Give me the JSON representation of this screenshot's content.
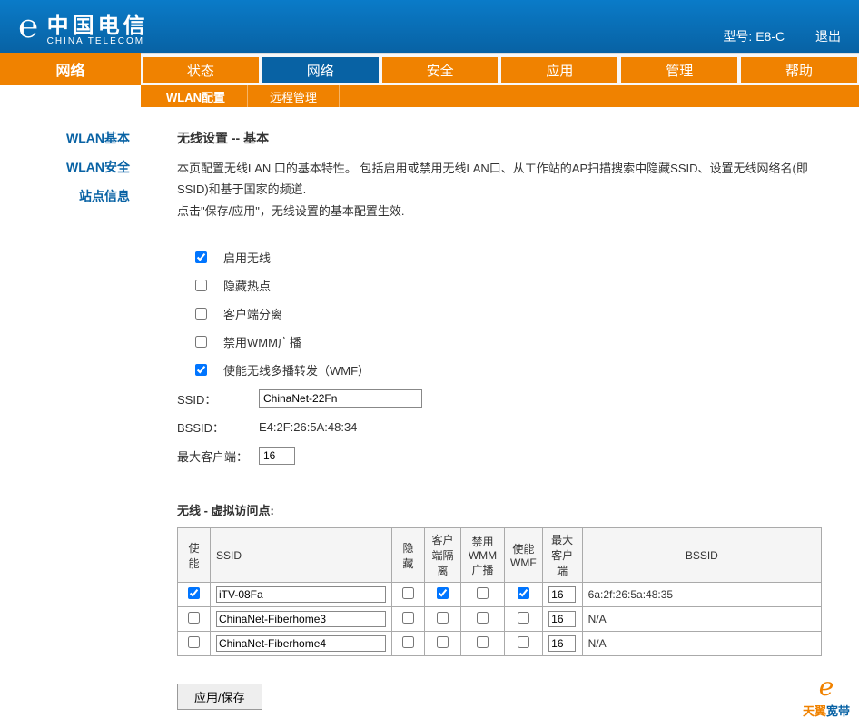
{
  "header": {
    "brand_cn": "中国电信",
    "brand_en": "CHINA TELECOM",
    "model_label": "型号: E8-C",
    "logout": "退出"
  },
  "nav": {
    "current": "网络",
    "tabs": [
      "状态",
      "网络",
      "安全",
      "应用",
      "管理",
      "帮助"
    ],
    "active_index": 1
  },
  "subnav": {
    "tabs": [
      "WLAN配置",
      "远程管理"
    ],
    "active_index": 0
  },
  "sidebar": {
    "items": [
      "WLAN基本",
      "WLAN安全",
      "站点信息"
    ]
  },
  "page": {
    "title": "无线设置 -- 基本",
    "desc_line1": "本页配置无线LAN 口的基本特性。 包括启用或禁用无线LAN口、从工作站的AP扫描搜索中隐藏SSID、设置无线网络名(即SSID)和基于国家的频道.",
    "desc_line2": "点击\"保存/应用\"，无线设置的基本配置生效."
  },
  "options": {
    "enable_wireless": {
      "label": "启用无线",
      "checked": true
    },
    "hide_ap": {
      "label": "隐藏热点",
      "checked": false
    },
    "client_isolation": {
      "label": "客户端分离",
      "checked": false
    },
    "disable_wmm_ad": {
      "label": "禁用WMM广播",
      "checked": false
    },
    "enable_wmf": {
      "label": "使能无线多播转发（WMF）",
      "checked": true
    }
  },
  "fields": {
    "ssid_label": "SSID：",
    "ssid_value": "ChinaNet-22Fn",
    "bssid_label": "BSSID：",
    "bssid_value": "E4:2F:26:5A:48:34",
    "max_clients_label": "最大客户端：",
    "max_clients_value": "16"
  },
  "vap": {
    "title": "无线 - 虚拟访问点:",
    "headers": {
      "enable": "使能",
      "ssid": "SSID",
      "hidden": "隐藏",
      "isolation": "客户端隔离",
      "disable_wmm": "禁用WMM广播",
      "enable_wmf": "使能WMF",
      "max_clients": "最大客户端",
      "bssid": "BSSID"
    },
    "rows": [
      {
        "enable": true,
        "ssid": "iTV-08Fa",
        "hidden": false,
        "isolation": true,
        "disable_wmm": false,
        "enable_wmf": true,
        "max_clients": "16",
        "bssid": "6a:2f:26:5a:48:35"
      },
      {
        "enable": false,
        "ssid": "ChinaNet-Fiberhome3",
        "hidden": false,
        "isolation": false,
        "disable_wmm": false,
        "enable_wmf": false,
        "max_clients": "16",
        "bssid": "N/A"
      },
      {
        "enable": false,
        "ssid": "ChinaNet-Fiberhome4",
        "hidden": false,
        "isolation": false,
        "disable_wmm": false,
        "enable_wmf": false,
        "max_clients": "16",
        "bssid": "N/A"
      }
    ]
  },
  "buttons": {
    "apply": "应用/保存"
  },
  "footer": {
    "brand": "天翼宽带"
  }
}
